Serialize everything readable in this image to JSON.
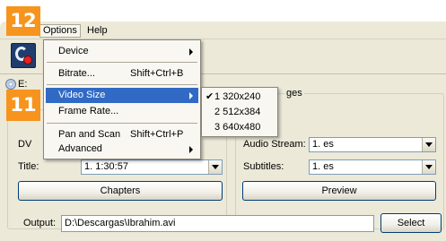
{
  "menubar": {
    "options": "Options",
    "help": "Help"
  },
  "drive_prefix": "E:",
  "options_menu": {
    "device": "Device",
    "bitrate": "Bitrate...",
    "bitrate_shortcut": "Shift+Ctrl+B",
    "video_size": "Video Size",
    "frame_rate": "Frame Rate...",
    "pan_scan": "Pan and Scan",
    "pan_scan_shortcut": "Shift+Ctrl+P",
    "advanced": "Advanced"
  },
  "video_size_submenu": {
    "checked_index": 0,
    "items": [
      "1 320x240",
      "2 512x384",
      "3 640x480"
    ]
  },
  "left_panel": {
    "dvd_label_partial": "DV",
    "title_label": "Title:",
    "title_value": "1. 1:30:57",
    "chapters_button": "Chapters"
  },
  "right_panel": {
    "legend_partial": "ges",
    "audio_label": "Audio Stream:",
    "audio_value": "1. es",
    "subtitles_label": "Subtitles:",
    "subtitles_value": "1. es",
    "preview_button": "Preview"
  },
  "output": {
    "label": "Output:",
    "value": "D:\\Descargas\\Ibrahim.avi",
    "select_button": "Select"
  },
  "callouts": {
    "a": "12",
    "b": "11",
    "color": "#f7941d"
  },
  "colors": {
    "highlight": "#316ac5",
    "window_bg": "#ece9d8"
  }
}
